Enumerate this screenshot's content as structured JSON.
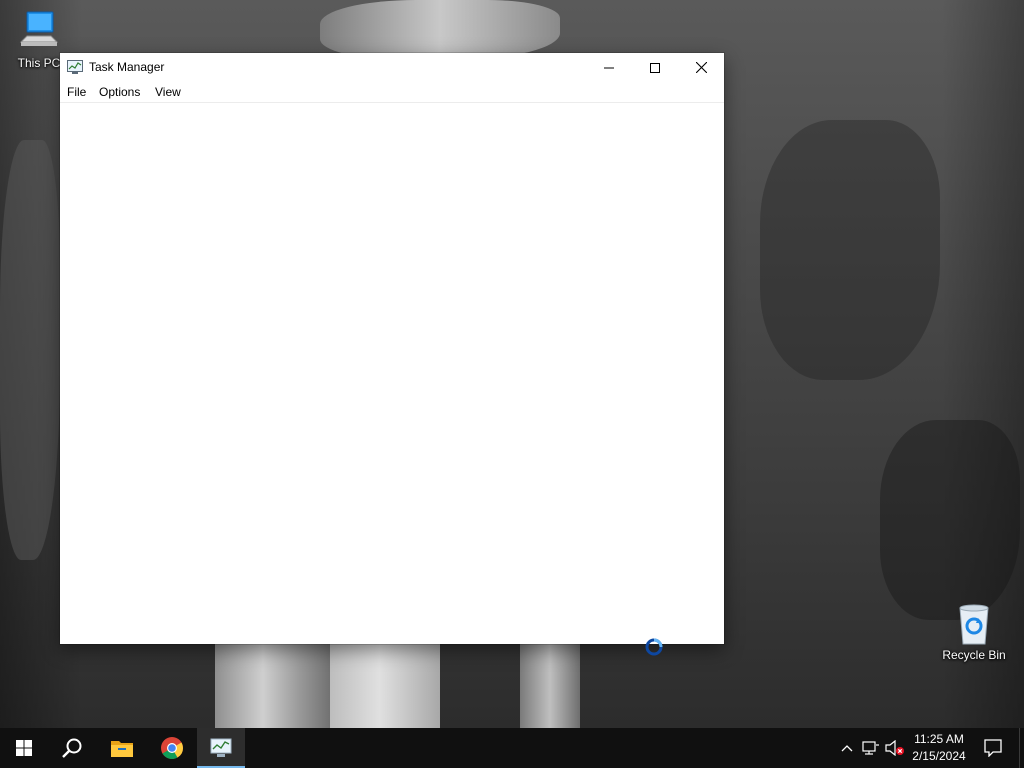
{
  "desktop": {
    "icons": [
      {
        "label": "This PC",
        "icon": "computer-icon"
      },
      {
        "label": "Recycle Bin",
        "icon": "recycle-bin-icon"
      }
    ]
  },
  "window": {
    "title": "Task Manager",
    "app_icon": "task-manager-icon",
    "controls": {
      "minimize": "minimize-icon",
      "maximize": "maximize-icon",
      "close": "close-icon"
    },
    "menu": [
      "File",
      "Options",
      "View"
    ]
  },
  "cursor": {
    "state": "busy"
  },
  "taskbar": {
    "buttons": [
      {
        "name": "Start",
        "icon": "windows-logo-icon"
      },
      {
        "name": "Search",
        "icon": "search-icon"
      },
      {
        "name": "File Explorer",
        "icon": "folder-icon"
      },
      {
        "name": "Google Chrome",
        "icon": "chrome-icon"
      },
      {
        "name": "Task Manager",
        "icon": "task-manager-icon",
        "active": true
      }
    ],
    "tray": {
      "time": "11:25 AM",
      "date": "2/15/2024"
    },
    "accent_color": "#76b9ed"
  }
}
